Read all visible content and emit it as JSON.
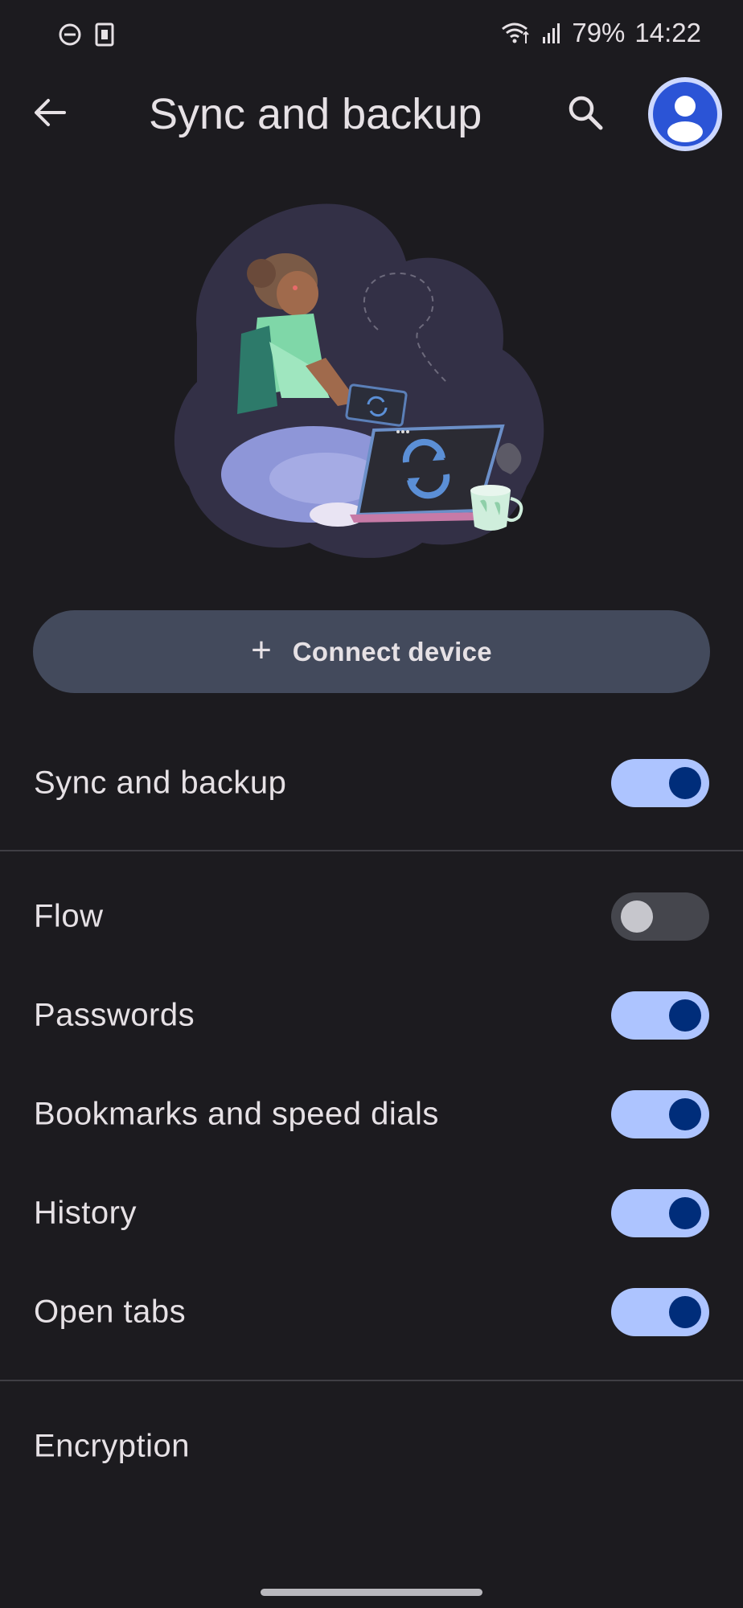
{
  "status_bar": {
    "battery": "79%",
    "time": "14:22"
  },
  "app_bar": {
    "title": "Sync and backup"
  },
  "connect_button": {
    "icon": "plus-icon",
    "label": "Connect device"
  },
  "main_toggle": {
    "label": "Sync and backup",
    "on": true
  },
  "sync_items": [
    {
      "label": "Flow",
      "on": false
    },
    {
      "label": "Passwords",
      "on": true
    },
    {
      "label": "Bookmarks and speed dials",
      "on": true
    },
    {
      "label": "History",
      "on": true
    },
    {
      "label": "Open tabs",
      "on": true
    }
  ],
  "encryption": {
    "label": "Encryption"
  },
  "colors": {
    "background": "#1c1b1f",
    "switch_on_track": "#adc4ff",
    "switch_on_thumb": "#002d7a",
    "switch_off_track": "#45464d",
    "button_bg": "#434a5c",
    "avatar_accent": "#2b54d6"
  }
}
